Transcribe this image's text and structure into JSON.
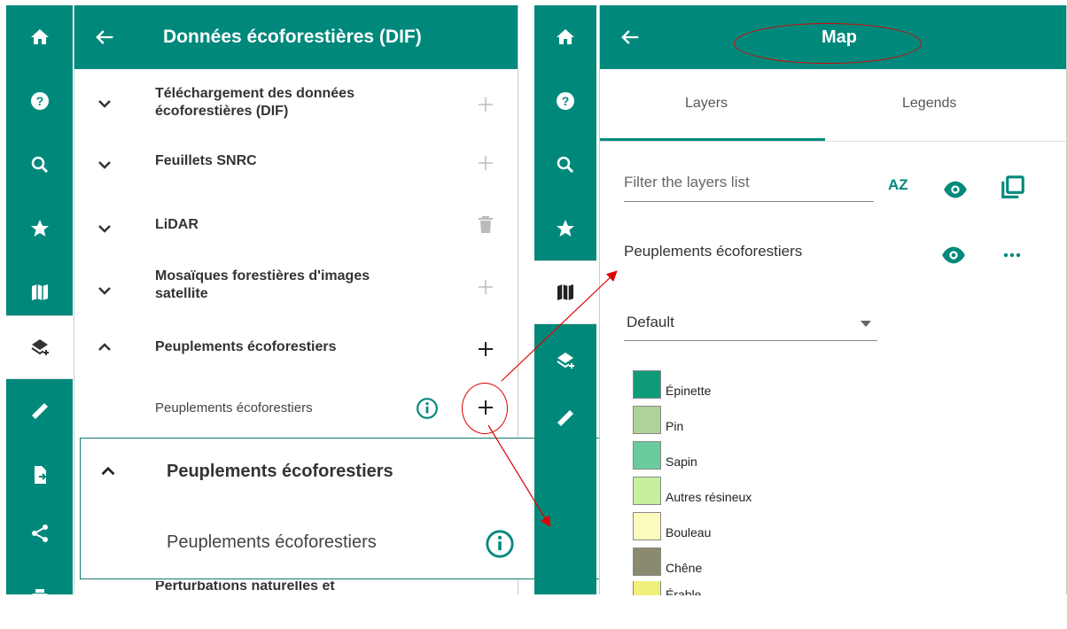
{
  "left_panel": {
    "title": "Données écoforestières (DIF)",
    "rows": [
      {
        "label_line1": "Téléchargement des données",
        "label_line2": "écoforestières (DIF)"
      },
      {
        "label": "Feuillets SNRC"
      },
      {
        "label": "LiDAR"
      },
      {
        "label_line1": "Mosaïques forestières d'images",
        "label_line2": "satellite"
      },
      {
        "label": "Peuplements écoforestiers"
      }
    ],
    "sub_item_label": "Peuplements écoforestiers",
    "bottom_partial_label": "Perturbations naturelles et"
  },
  "popup": {
    "group_label": "Peuplements écoforestiers",
    "item_label": "Peuplements écoforestiers"
  },
  "right_panel": {
    "title": "Map",
    "tabs": [
      "Layers",
      "Legends"
    ],
    "filter_placeholder": "Filter the layers list",
    "sort_label": "AZ",
    "layer_name": "Peuplements écoforestiers",
    "style_value": "Default",
    "legend": [
      {
        "label": "Épinette",
        "color": "#0f9b78"
      },
      {
        "label": "Pin",
        "color": "#add39a"
      },
      {
        "label": "Sapin",
        "color": "#6acb9f"
      },
      {
        "label": "Autres résineux",
        "color": "#c6f0a0"
      },
      {
        "label": "Bouleau",
        "color": "#fbfbbd"
      },
      {
        "label": "Chêne",
        "color": "#8c8a6e"
      },
      {
        "label": "Érable",
        "color": "#eef07a"
      }
    ]
  },
  "colors": {
    "teal": "#00897b",
    "delete_red": "#f44336",
    "annotation_red": "#dd0000"
  }
}
